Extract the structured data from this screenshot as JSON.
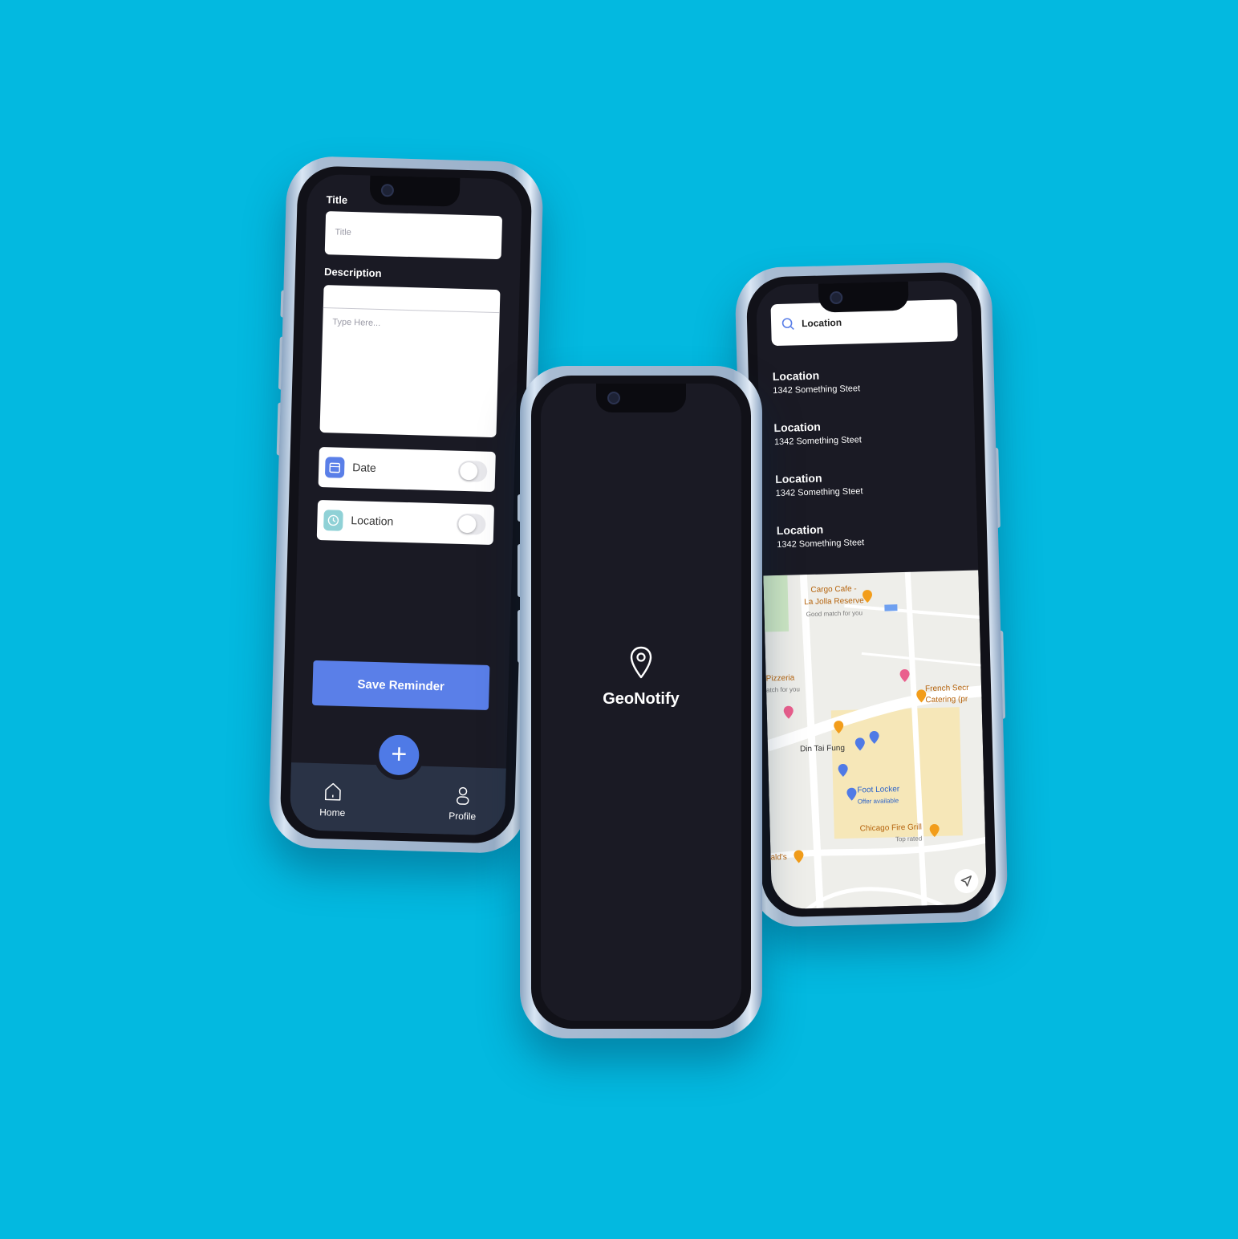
{
  "app_name": "GeoNotify",
  "colors": {
    "background": "#03b9e0",
    "screen_dark": "#1a1a24",
    "accent": "#5a7fe8",
    "tabbar": "#2a3346"
  },
  "reminder_form": {
    "title_label": "Title",
    "title_placeholder": "Title",
    "description_label": "Description",
    "description_placeholder": "Type Here...",
    "toggles": [
      {
        "label": "Date",
        "icon": "calendar-icon",
        "enabled": false
      },
      {
        "label": "Location",
        "icon": "clock-icon",
        "enabled": false
      }
    ],
    "save_label": "Save Reminder",
    "fab_icon": "plus-icon",
    "nav": [
      {
        "label": "Home",
        "icon": "home-icon"
      },
      {
        "label": "Profile",
        "icon": "profile-icon"
      }
    ]
  },
  "splash": {
    "icon": "location-pin-icon",
    "title": "GeoNotify"
  },
  "location_search": {
    "search_value": "Location",
    "results": [
      {
        "title": "Location",
        "address": "1342 Something Steet"
      },
      {
        "title": "Location",
        "address": "1342 Something Steet"
      },
      {
        "title": "Location",
        "address": "1342 Something Steet"
      },
      {
        "title": "Location",
        "address": "1342 Something Steet"
      }
    ],
    "map_places": [
      {
        "name": "Cargo Cafe -",
        "sub": "La Jolla Reserve",
        "note": "Good match for you"
      },
      {
        "name": "Pizzeria",
        "note": "atch for you"
      },
      {
        "name": "French Secr",
        "sub": "Catering (pr"
      },
      {
        "name": "Din Tai Fung"
      },
      {
        "name": "Foot Locker",
        "note": "Offer available"
      },
      {
        "name": "Chicago Fire Grill",
        "note": "Top rated"
      },
      {
        "name": "ald's"
      }
    ]
  }
}
